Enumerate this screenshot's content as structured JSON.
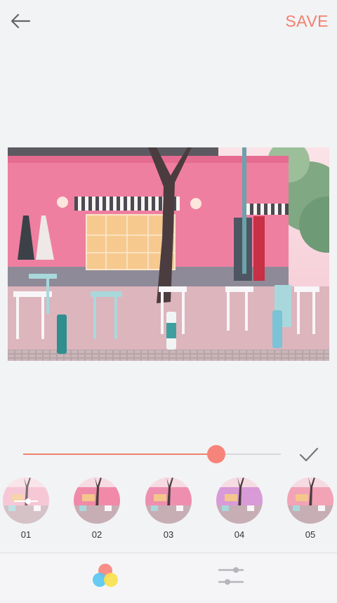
{
  "header": {
    "save_label": "SAVE",
    "back_icon": "arrow-left-icon"
  },
  "colors": {
    "accent": "#f0826e",
    "thumb": "#f7847a",
    "background": "#f2f3f5"
  },
  "adjustment": {
    "intensity": 0.75
  },
  "filters": [
    {
      "label": "01",
      "selected": true
    },
    {
      "label": "02",
      "selected": false
    },
    {
      "label": "03",
      "selected": false
    },
    {
      "label": "04",
      "selected": false
    },
    {
      "label": "05",
      "selected": false
    }
  ],
  "tabs": [
    {
      "icon": "filters-icon",
      "active": true
    },
    {
      "icon": "adjust-sliders-icon",
      "active": false
    }
  ]
}
